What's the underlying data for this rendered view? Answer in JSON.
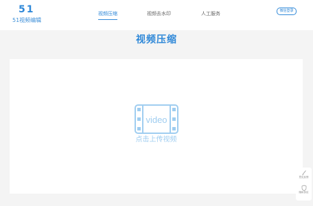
{
  "header": {
    "logo_mark": "51",
    "logo_text": "51视频编辑",
    "nav": [
      {
        "label": "视频压缩",
        "active": true
      },
      {
        "label": "视频去水印",
        "active": false
      },
      {
        "label": "人工服务",
        "active": false
      }
    ],
    "login_label": "微信登录"
  },
  "main": {
    "title": "视频压缩",
    "upload": {
      "icon_text": "video",
      "label": "点击上传视频"
    }
  },
  "side_panel": {
    "items": [
      {
        "label": "意见反馈",
        "icon": "pen-icon"
      },
      {
        "label": "隐私协议",
        "icon": "shield-icon"
      }
    ]
  },
  "colors": {
    "accent": "#2f88d8",
    "upload_light": "#9fcdf0",
    "background": "#f4f4f4"
  }
}
